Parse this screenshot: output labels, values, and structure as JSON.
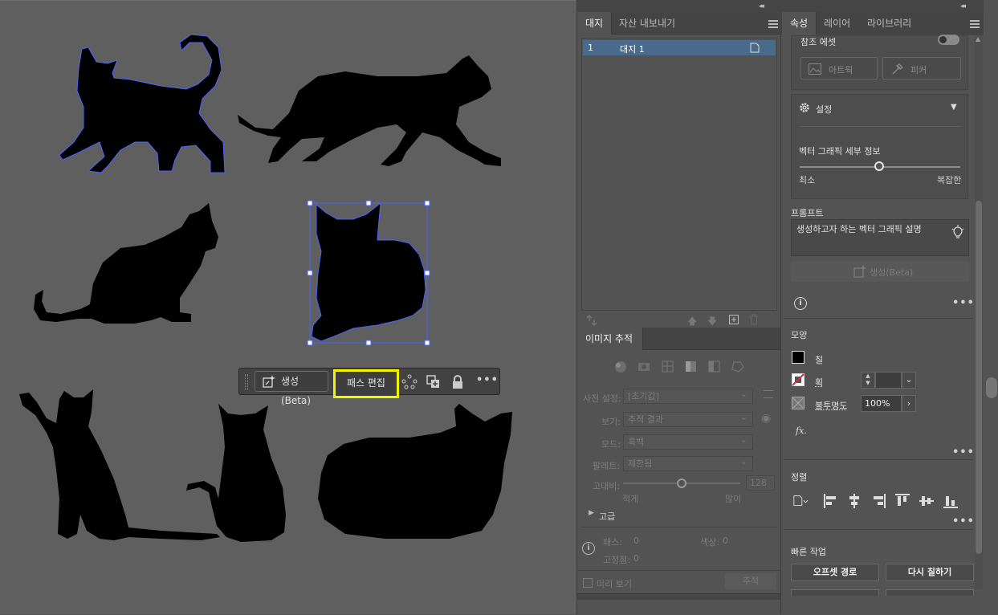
{
  "canvas": {
    "toolbar": {
      "generate_label": "생성(Beta)",
      "edit_path_label": "패스 편집"
    }
  },
  "artboards_panel": {
    "tabs": [
      "대지",
      "자산 내보내기"
    ],
    "rows": [
      {
        "number": "1",
        "name": "대지 1"
      }
    ]
  },
  "image_trace_panel": {
    "tab": "이미지 추적",
    "preset_label": "사전 설정:",
    "preset_value": "[초기값]",
    "view_label": "보기:",
    "view_value": "추적 결과",
    "mode_label": "모드:",
    "mode_value": "흑백",
    "palette_label": "팔레트:",
    "palette_value": "제한됨",
    "threshold_label": "고대비:",
    "threshold_value": "128",
    "threshold_min": "적게",
    "threshold_max": "많이",
    "advanced_label": "고급",
    "paths_label": "패스:",
    "paths_value": "0",
    "colors_label": "색상:",
    "colors_value": "0",
    "anchors_label": "고정점:",
    "anchors_value": "0",
    "preview_label": "미리 보기",
    "trace_button": "추적"
  },
  "properties_panel": {
    "tabs": [
      "속성",
      "레이어",
      "라이브러리"
    ],
    "reference_asset_label": "참조 에셋",
    "artwork_button": "아트웍",
    "picker_button": "피커",
    "settings_label": "설정",
    "vector_detail_label": "벡터 그래픽 세부 정보",
    "detail_min": "최소",
    "detail_max": "복잡한",
    "prompt_label": "프롬프트",
    "prompt_placeholder": "생성하고자 하는 벡터 그래픽 설명",
    "generate_button": "생성(Beta)",
    "appearance_label": "모양",
    "fill_label": "칠",
    "stroke_label": "획",
    "opacity_label": "불투명도",
    "opacity_value": "100%",
    "fx_label": "fx.",
    "align_label": "정렬",
    "quick_actions_label": "빠른 작업",
    "offset_path_button": "오프셋 경로",
    "recolor_button": "다시 칠하기"
  },
  "colors": {
    "selection_outline": "#4a63ff",
    "highlight_box": "#f4f400",
    "selected_row": "#4a6a8c",
    "fill_swatch": "#000000"
  }
}
